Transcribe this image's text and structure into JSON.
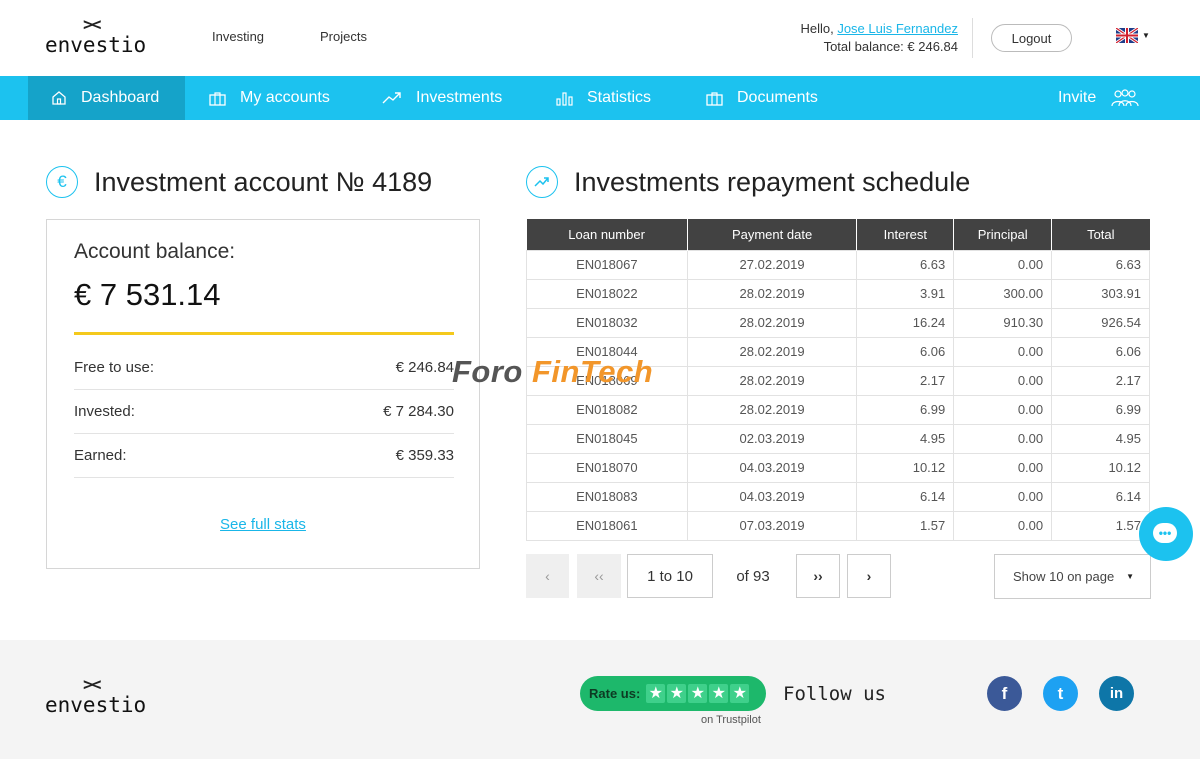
{
  "header": {
    "logo_mark": "><",
    "logo_word": "envestio",
    "links": [
      "Investing",
      "Projects"
    ],
    "greeting_prefix": "Hello, ",
    "user_name": "Jose Luis Fernandez",
    "balance_label": "Total balance: € 246.84",
    "logout_label": "Logout",
    "language_icon": "uk-flag-icon"
  },
  "nav": {
    "items": [
      {
        "label": "Dashboard",
        "icon": "home-icon"
      },
      {
        "label": "My accounts",
        "icon": "briefcase-icon"
      },
      {
        "label": "Investments",
        "icon": "trend-up-icon"
      },
      {
        "label": "Statistics",
        "icon": "bar-chart-icon"
      },
      {
        "label": "Documents",
        "icon": "document-icon"
      }
    ],
    "invite_label": "Invite",
    "invite_icon": "people-icon"
  },
  "account": {
    "title": "Investment account № 4189",
    "icon": "euro-icon",
    "balance_label": "Account balance:",
    "balance_value": "€ 7 531.14",
    "rows": [
      {
        "label": "Free to use:",
        "value": "€ 246.84"
      },
      {
        "label": "Invested:",
        "value": "€ 7 284.30"
      },
      {
        "label": "Earned:",
        "value": "€ 359.33"
      }
    ],
    "see_full_stats": "See full stats"
  },
  "schedule": {
    "title": "Investments repayment schedule",
    "icon": "trend-up-icon",
    "columns": [
      "Loan number",
      "Payment date",
      "Interest",
      "Principal",
      "Total"
    ],
    "rows": [
      [
        "EN018067",
        "27.02.2019",
        "6.63",
        "0.00",
        "6.63"
      ],
      [
        "EN018022",
        "28.02.2019",
        "3.91",
        "300.00",
        "303.91"
      ],
      [
        "EN018032",
        "28.02.2019",
        "16.24",
        "910.30",
        "926.54"
      ],
      [
        "EN018044",
        "28.02.2019",
        "6.06",
        "0.00",
        "6.06"
      ],
      [
        "EN018069",
        "28.02.2019",
        "2.17",
        "0.00",
        "2.17"
      ],
      [
        "EN018082",
        "28.02.2019",
        "6.99",
        "0.00",
        "6.99"
      ],
      [
        "EN018045",
        "02.03.2019",
        "4.95",
        "0.00",
        "4.95"
      ],
      [
        "EN018070",
        "04.03.2019",
        "10.12",
        "0.00",
        "10.12"
      ],
      [
        "EN018083",
        "04.03.2019",
        "6.14",
        "0.00",
        "6.14"
      ],
      [
        "EN018061",
        "07.03.2019",
        "1.57",
        "0.00",
        "1.57"
      ]
    ],
    "pagination": {
      "prev": "‹",
      "first": "‹‹",
      "range": "1 to 10",
      "of_total": "of 93",
      "last": "››",
      "next": "›",
      "page_size": "Show 10 on page"
    }
  },
  "watermark": {
    "part1": "Foro ",
    "part2": "FinTech"
  },
  "footer": {
    "logo_mark": "><",
    "logo_word": "envestio",
    "rate_us": "Rate us:",
    "on_trustpilot": "on Trustpilot",
    "follow_us": "Follow us",
    "social": [
      {
        "name": "facebook-icon",
        "glyph": "f",
        "color": "#3b5998"
      },
      {
        "name": "twitter-icon",
        "glyph": "t",
        "color": "#1da1f2"
      },
      {
        "name": "linkedin-icon",
        "glyph": "in",
        "color": "#0e76a8"
      }
    ]
  },
  "colors": {
    "accent": "#1cc2ef",
    "nav_active": "#15a3c9",
    "balance_bar": "#f4c91c",
    "trustpilot": "#1db86b"
  }
}
